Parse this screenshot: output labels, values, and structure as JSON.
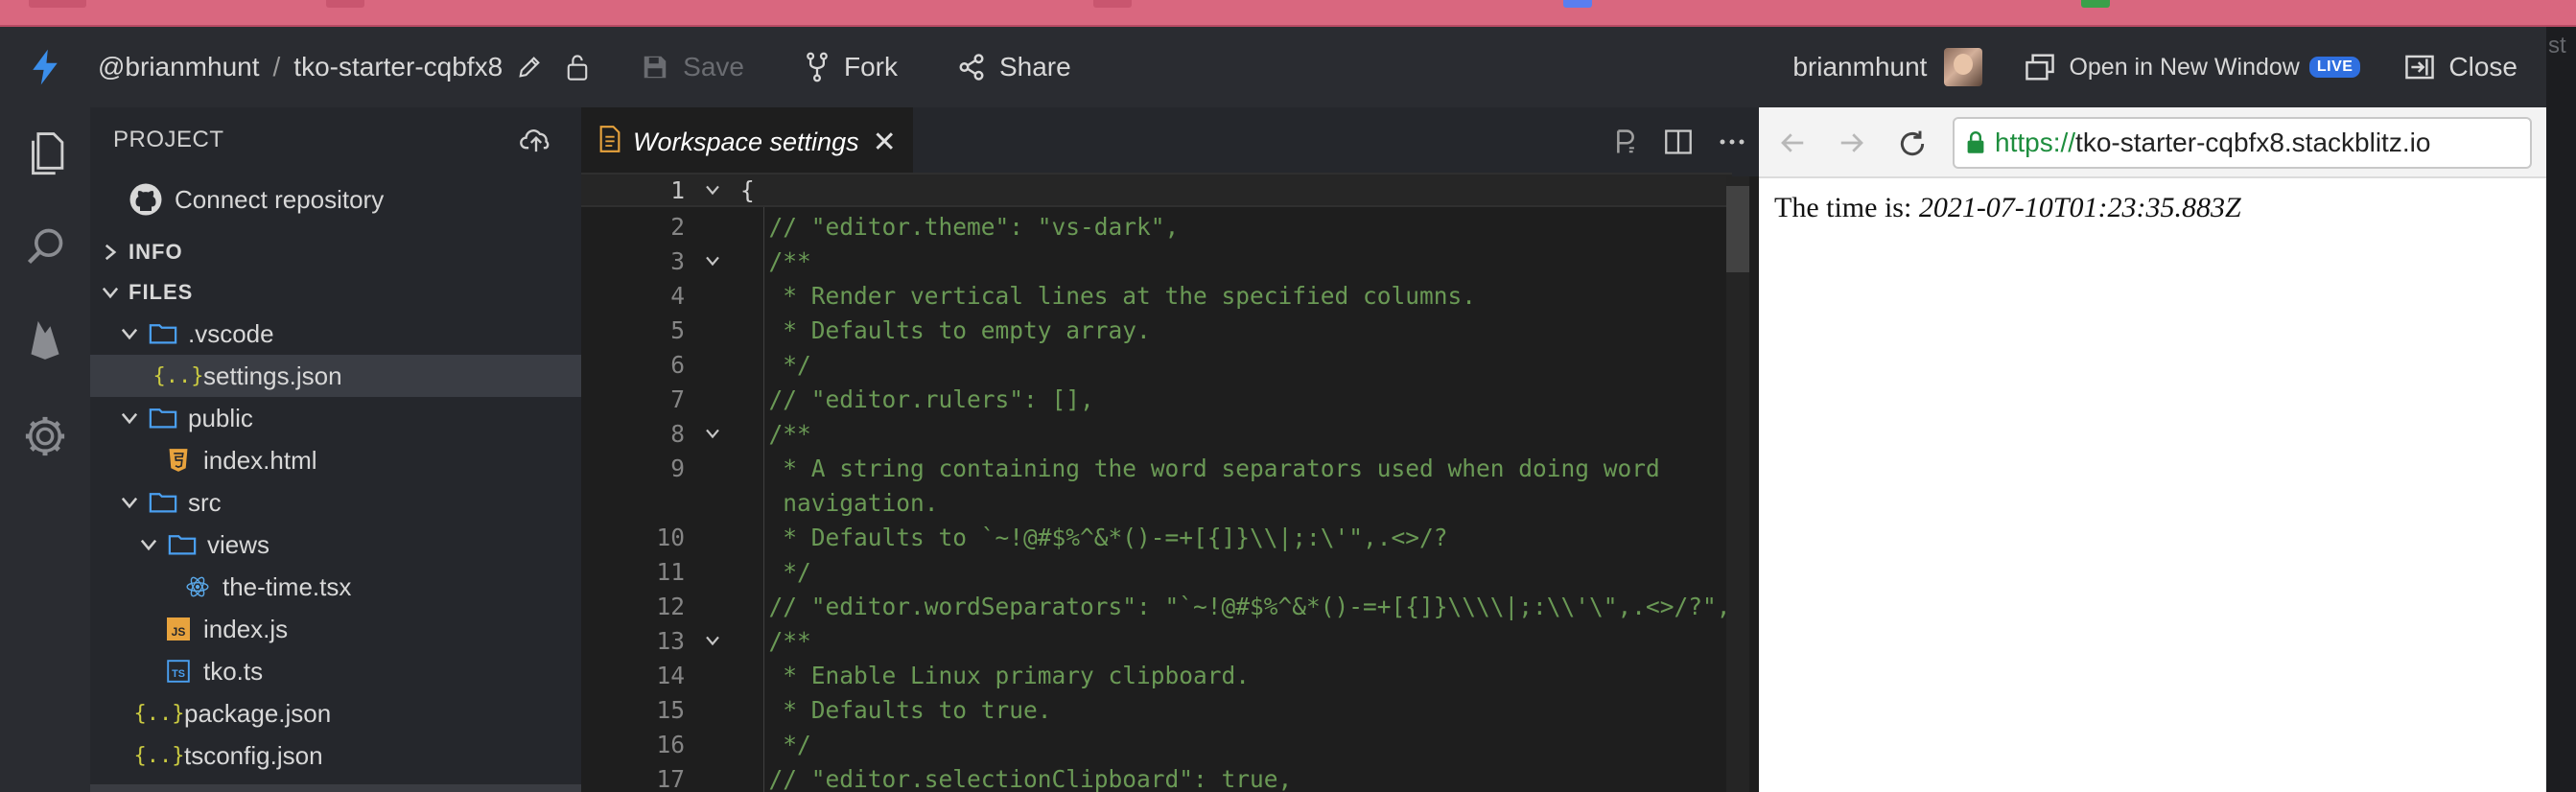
{
  "header": {
    "owner": "@brianmhunt",
    "project": "tko-starter-cqbfx8",
    "save_label": "Save",
    "fork_label": "Fork",
    "share_label": "Share",
    "username": "brianmhunt",
    "open_window_label": "Open in New Window",
    "live_badge": "LIVE",
    "close_label": "Close"
  },
  "sidebar": {
    "project_label": "PROJECT",
    "connect_repo": "Connect repository",
    "sections": {
      "info": "INFO",
      "files": "FILES"
    },
    "tree": [
      {
        "label": ".vscode",
        "type": "folder",
        "expanded": true
      },
      {
        "label": "settings.json",
        "type": "json",
        "selected": true
      },
      {
        "label": "public",
        "type": "folder",
        "expanded": true
      },
      {
        "label": "index.html",
        "type": "html"
      },
      {
        "label": "src",
        "type": "folder",
        "expanded": true
      },
      {
        "label": "views",
        "type": "folder",
        "expanded": true
      },
      {
        "label": "the-time.tsx",
        "type": "react"
      },
      {
        "label": "index.js",
        "type": "js"
      },
      {
        "label": "tko.ts",
        "type": "ts"
      },
      {
        "label": "package.json",
        "type": "json"
      },
      {
        "label": "tsconfig.json",
        "type": "json"
      }
    ]
  },
  "editor": {
    "tab_title": "Workspace settings",
    "lines": [
      {
        "n": "1",
        "text": "{"
      },
      {
        "n": "2",
        "text": "  // \"editor.theme\": \"vs-dark\","
      },
      {
        "n": "3",
        "text": "  /**"
      },
      {
        "n": "4",
        "text": "   * Render vertical lines at the specified columns."
      },
      {
        "n": "5",
        "text": "   * Defaults to empty array."
      },
      {
        "n": "6",
        "text": "   */"
      },
      {
        "n": "7",
        "text": "  // \"editor.rulers\": [],"
      },
      {
        "n": "8",
        "text": "  /**"
      },
      {
        "n": "9",
        "text": "   * A string containing the word separators used when doing word"
      },
      {
        "n": "",
        "text": "   navigation."
      },
      {
        "n": "10",
        "text": "   * Defaults to `~!@#$%^&*()-=+[{]}\\\\|;:\\'\",.<>/?"
      },
      {
        "n": "11",
        "text": "   */"
      },
      {
        "n": "12",
        "text": "  // \"editor.wordSeparators\": \"`~!@#$%^&*()-=+[{]}\\\\\\\\|;:\\\\'\\\",.<>/?\","
      },
      {
        "n": "13",
        "text": "  /**"
      },
      {
        "n": "14",
        "text": "   * Enable Linux primary clipboard."
      },
      {
        "n": "15",
        "text": "   * Defaults to true."
      },
      {
        "n": "16",
        "text": "   */"
      },
      {
        "n": "17",
        "text": "  // \"editor.selectionClipboard\": true,"
      }
    ]
  },
  "preview": {
    "url_scheme": "https://",
    "url_host": "tko-starter-cqbfx8.stackblitz.io",
    "content_label": "The time is:",
    "content_time": "2021-07-10T01:23:35.883Z"
  },
  "edge_text": "st",
  "colors": {
    "tab_strip": "#d9677f",
    "header_bg": "#2a2c31",
    "sidebar_bg": "#25272c",
    "editor_bg": "#1e1e1e",
    "comment": "#6a9955",
    "accent": "#3b8eea",
    "live_badge": "#2f6fe0"
  }
}
